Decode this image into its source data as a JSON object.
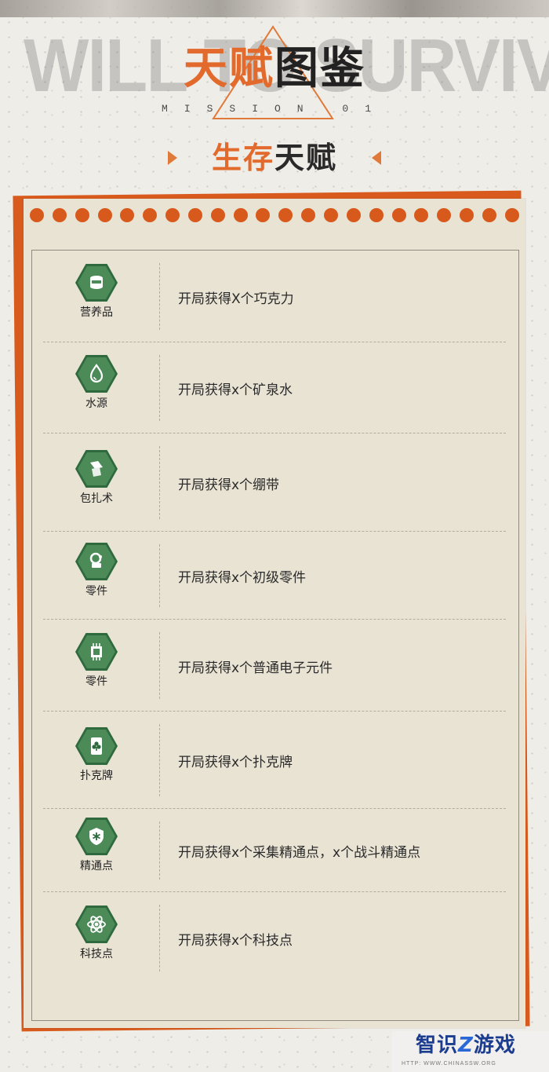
{
  "header": {
    "bg_text": "WILL TO SURVIVE",
    "title_part1": "天赋",
    "title_part2": "图鉴",
    "subtitle": "MISSION 01",
    "section_part1": "生存",
    "section_part2": "天赋"
  },
  "talents": [
    {
      "icon": "food-can-icon",
      "label": "营养品",
      "desc": "开局获得X个巧克力"
    },
    {
      "icon": "water-drop-icon",
      "label": "水源",
      "desc": "开局获得x个矿泉水"
    },
    {
      "icon": "bandage-icon",
      "label": "包扎术",
      "desc": "开局获得x个绷带"
    },
    {
      "icon": "parts-icon",
      "label": "零件",
      "desc": "开局获得x个初级零件"
    },
    {
      "icon": "chip-icon",
      "label": "零件",
      "desc": "开局获得x个普通电子元件"
    },
    {
      "icon": "club-card-icon",
      "label": "扑克牌",
      "desc": "开局获得x个扑克牌"
    },
    {
      "icon": "shield-star-icon",
      "label": "精通点",
      "desc": "开局获得x个采集精通点，x个战斗精通点"
    },
    {
      "icon": "tech-atom-icon",
      "label": "科技点",
      "desc": "开局获得x个科技点"
    }
  ],
  "watermark": {
    "main_part1": "智识",
    "main_z": "Z",
    "main_part2": "游戏",
    "sub": "HTTP: WWW.CHINASSW.ORG"
  },
  "colors": {
    "accent_orange": "#d7591c",
    "icon_green": "#2e6a3e",
    "paper": "#e9e3d4"
  }
}
